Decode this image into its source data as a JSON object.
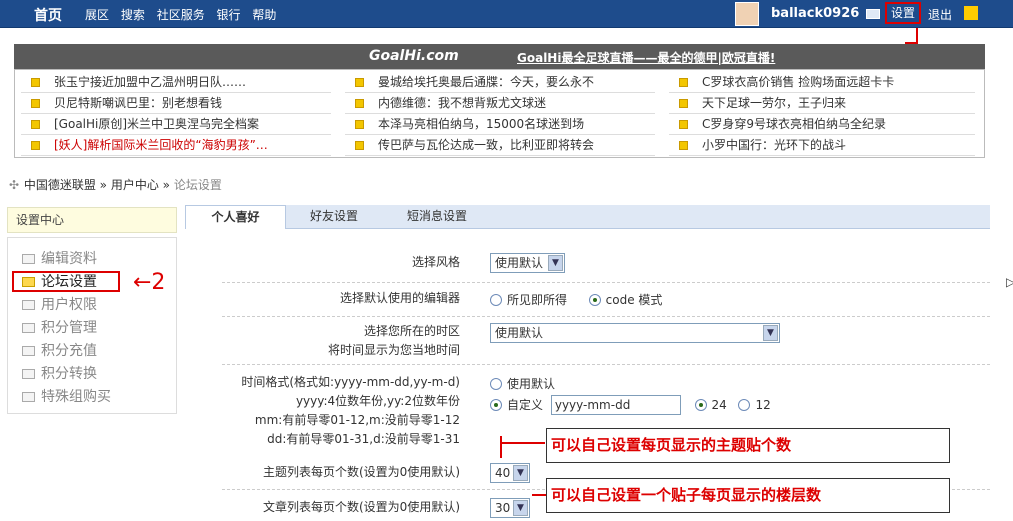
{
  "topbar": {
    "home": "首页",
    "nav": [
      "展区",
      "搜索",
      "社区服务",
      "银行",
      "帮助"
    ],
    "username": "ballack0926",
    "settings": "设置",
    "logout": "退出"
  },
  "banner": {
    "logo": "GoalHi.com",
    "slogan": "GoalHi最全足球直播——最全的德甲|欧冠直播!"
  },
  "news": {
    "col1": [
      "张玉宁接近加盟中乙温州明日队……",
      "贝尼特斯嘲讽巴里：别老想看钱",
      "[GoalHi原创]米兰中卫奥涅乌完全档案",
      "[妖人]解析国际米兰回收的“海豹男孩”…"
    ],
    "col2": [
      "曼城给埃托奥最后通牒：今天，要么永不",
      "内德维德：我不想背叛尤文球迷",
      "本泽马亮相伯纳乌，15000名球迷到场",
      "传巴萨与瓦伦达成一致，比利亚即将转会"
    ],
    "col3": [
      "C罗球衣高价销售 捡购场面远超卡卡",
      "天下足球一劳尔，王子归来",
      "C罗身穿9号球衣亮相伯纳乌全纪录",
      "小罗中国行：光环下的战斗"
    ]
  },
  "breadcrumb": [
    "中国德迷联盟",
    "用户中心",
    "论坛设置"
  ],
  "sidebar": {
    "header": "设置中心",
    "items": [
      "编辑资料",
      "论坛设置",
      "用户权限",
      "积分管理",
      "积分充值",
      "积分转换",
      "特殊组购买"
    ]
  },
  "annotation2": "←2",
  "tabs": [
    "个人喜好",
    "好友设置",
    "短消息设置"
  ],
  "form": {
    "style_label": "选择风格",
    "style_value": "使用默认",
    "editor_label": "选择默认使用的编辑器",
    "editor_opt1": "所见即所得",
    "editor_opt2": "code 模式",
    "timezone_label1": "选择您所在的时区",
    "timezone_label2": "将时间显示为您当地时间",
    "timezone_value": "使用默认",
    "timefmt_label1": "时间格式(格式如:yyyy-mm-dd,yy-m-d)",
    "timefmt_label2": "yyyy:4位数年份,yy:2位数年份",
    "timefmt_label3": "mm:有前导零01-12,m:没前导零1-12",
    "timefmt_label4": "dd:有前导零01-31,d:没前导零1-31",
    "timefmt_default": "使用默认",
    "timefmt_custom": "自定义",
    "timefmt_value": "yyyy-mm-dd",
    "h24": "24",
    "h12": "12",
    "topics_label": "主题列表每页个数(设置为0使用默认)",
    "topics_value": "40",
    "posts_label": "文章列表每页个数(设置为0使用默认)",
    "posts_value": "30"
  },
  "annotations": {
    "topics": "可以自己设置每页显示的主题贴个数",
    "posts": "可以自己设置一个贴子每页显示的楼层数"
  }
}
